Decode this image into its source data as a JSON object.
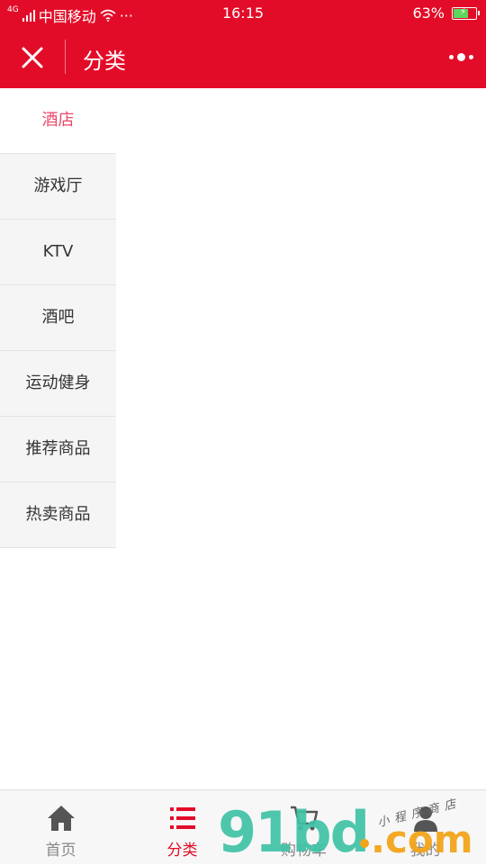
{
  "status_bar": {
    "network_type": "4G",
    "carrier": "中国移动",
    "more": "···",
    "time": "16:15",
    "battery_percent": "63%",
    "battery_level": 0.63
  },
  "navbar": {
    "title": "分类",
    "close_icon": "close-icon",
    "more_icon": "capsule-more-icon"
  },
  "categories": [
    {
      "label": "酒店",
      "active": true
    },
    {
      "label": "游戏厅",
      "active": false
    },
    {
      "label": "KTV",
      "active": false
    },
    {
      "label": "酒吧",
      "active": false
    },
    {
      "label": "运动健身",
      "active": false
    },
    {
      "label": "推荐商品",
      "active": false
    },
    {
      "label": "热卖商品",
      "active": false
    }
  ],
  "tabbar": {
    "tabs": [
      {
        "label": "首页",
        "icon": "home-icon",
        "active": false
      },
      {
        "label": "分类",
        "icon": "list-icon",
        "active": true
      },
      {
        "label": "购物车",
        "icon": "cart-icon",
        "active": false
      },
      {
        "label": "我的",
        "icon": "user-icon",
        "active": false
      }
    ]
  },
  "watermark": {
    "brand": "91bd",
    "suffix": ".com",
    "tagline": "小程序商店"
  },
  "colors": {
    "primary": "#e30c28",
    "active_category_text": "#e8486a",
    "sidebar_bg": "#f5f5f5",
    "tab_inactive": "#888888",
    "watermark_green": "#3fc2a6",
    "watermark_orange": "#f2a51a"
  }
}
